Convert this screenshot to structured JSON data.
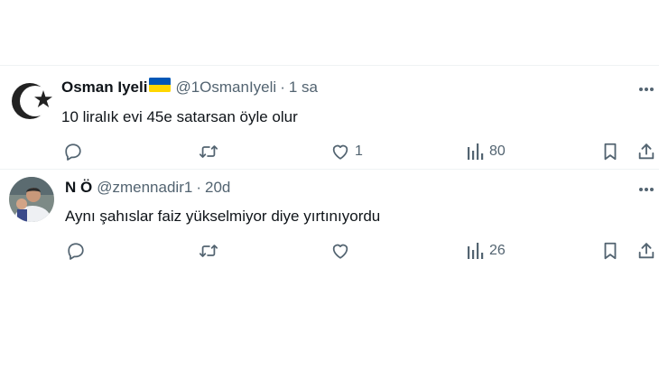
{
  "tweets": [
    {
      "name": "Osman Iyeli",
      "flag": "ukraine-flag",
      "handle": "@1OsmanIyeli",
      "separator": "·",
      "time": "1 sa",
      "text": "10 liralık evi 45e satarsan öyle olur",
      "replies": "",
      "retweets": "",
      "likes": "1",
      "views": "80"
    },
    {
      "name": "N Ö",
      "handle": "@zmennadir1",
      "separator": "·",
      "time": "20d",
      "text": "Aynı şahıslar faiz yükselmiyor diye yırtınıyordu",
      "replies": "",
      "retweets": "",
      "likes": "",
      "views": "26"
    }
  ],
  "colors": {
    "text": "#0f1419",
    "secondary": "#536471",
    "divider": "#eff3f4",
    "flag_blue": "#0057b7",
    "flag_yellow": "#ffd700"
  },
  "icons": [
    "more-icon",
    "reply-icon",
    "retweet-icon",
    "like-icon",
    "views-icon",
    "bookmark-icon",
    "share-icon"
  ]
}
